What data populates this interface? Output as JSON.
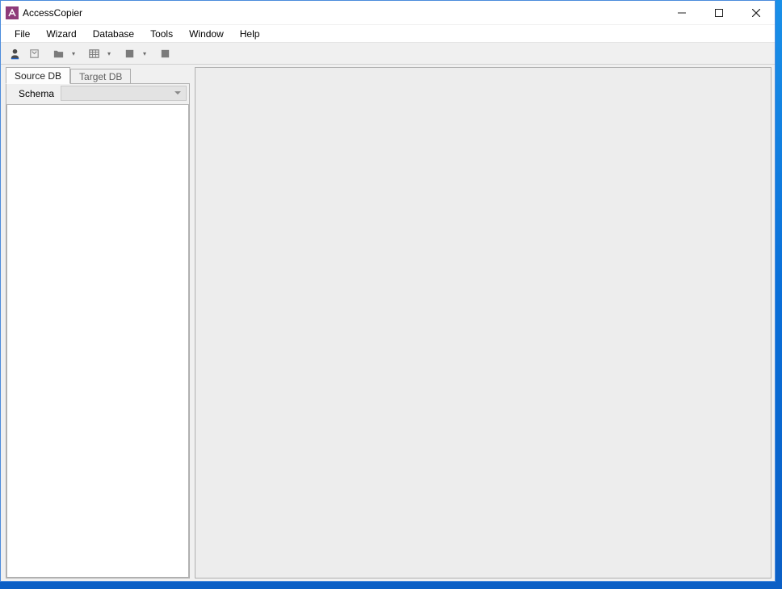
{
  "window": {
    "title": "AccessCopier"
  },
  "menu": {
    "items": [
      "File",
      "Wizard",
      "Database",
      "Tools",
      "Window",
      "Help"
    ]
  },
  "toolbar": {
    "buttons": [
      {
        "name": "user-icon"
      },
      {
        "name": "wizard-icon"
      },
      {
        "name": "folder-icon",
        "dropdown": true
      },
      {
        "name": "table-icon",
        "dropdown": true
      },
      {
        "name": "square-icon",
        "dropdown": true
      },
      {
        "name": "stop-icon"
      }
    ]
  },
  "sidebar": {
    "tabs": [
      {
        "label": "Source DB",
        "active": true
      },
      {
        "label": "Target DB",
        "active": false
      }
    ],
    "schema_label": "Schema",
    "schema_value": ""
  }
}
